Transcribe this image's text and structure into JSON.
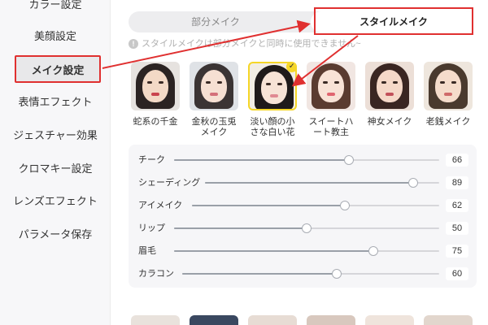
{
  "sidebar": {
    "items": [
      {
        "label": "カラー設定"
      },
      {
        "label": "美顔設定"
      },
      {
        "label": "メイク設定"
      },
      {
        "label": "表情エフェクト"
      },
      {
        "label": "ジェスチャー効果"
      },
      {
        "label": "クロマキー設定"
      },
      {
        "label": "レンズエフェクト"
      },
      {
        "label": "パラメータ保存"
      }
    ]
  },
  "tabs": {
    "partial": "部分メイク",
    "style": "スタイルメイク"
  },
  "notice": {
    "icon": "info-icon",
    "text": "スタイルメイクは部分メイクと同時に使用できません~"
  },
  "styles": [
    {
      "label": "蛇系の千金"
    },
    {
      "label": "金秋の玉兎メイク"
    },
    {
      "label": "淡い顔の小さな白い花"
    },
    {
      "label": "スイートハート教主"
    },
    {
      "label": "神女メイク"
    },
    {
      "label": "老銭メイク"
    }
  ],
  "sliders": [
    {
      "label": "チーク",
      "value": 66
    },
    {
      "label": "シェーディング",
      "value": 89
    },
    {
      "label": "アイメイク",
      "value": 62
    },
    {
      "label": "リップ",
      "value": 50
    },
    {
      "label": "眉毛",
      "value": 75
    },
    {
      "label": "カラコン",
      "value": 60
    }
  ],
  "colors": {
    "accent_red": "#e03030",
    "selected_yellow": "#f5d628"
  }
}
